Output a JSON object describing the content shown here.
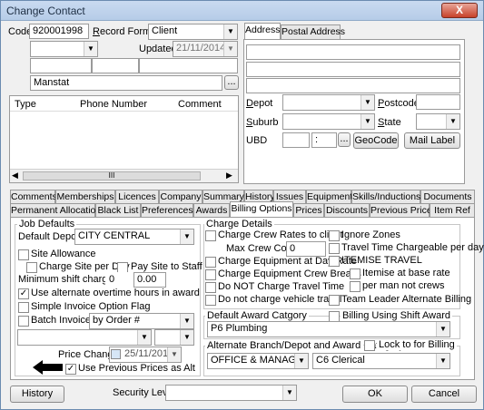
{
  "window": {
    "title": "Change Contact",
    "close_label": "X"
  },
  "header": {
    "code_label": "Code",
    "code_value": "920001998",
    "record_format_label": "Record Format",
    "record_format_value": "Client",
    "updated_label": "Updated",
    "updated_value": "21/11/2014",
    "name_value": "Manstat",
    "more_button": "..."
  },
  "phones": {
    "columns": [
      "Type",
      "Phone Number",
      "Comment"
    ],
    "scroll_grip": "III"
  },
  "address": {
    "tabs": [
      "Address",
      "Postal Address"
    ],
    "depot_label": "Depot",
    "postcode_label": "Postcode",
    "suburb_label": "Suburb",
    "state_label": "State",
    "ubd_label": "UBD",
    "ubd_sep": ":",
    "ubd_more": "...",
    "geocode_button": "GeoCode",
    "mail_label_button": "Mail Label"
  },
  "main_tabs": [
    "Comments",
    "Memberships",
    "Licences",
    "Company",
    "Summary",
    "History",
    "Issues",
    "Equipment",
    "Skills/Inductions",
    "Documents",
    "Permanent Allocations",
    "Black List",
    "Preferences",
    "Awards",
    "Billing Options",
    "Prices",
    "Discounts",
    "Previous Prices",
    "Item Ref"
  ],
  "job_defaults": {
    "group_label": "Job Defaults",
    "default_depot_label": "Default Depot",
    "default_depot_value": "CITY CENTRAL",
    "site_allowance": "Site Allowance",
    "charge_site_per_day": "Charge Site per Day",
    "pay_site_to_staff": "Pay Site to Staff",
    "min_shift_label": "Minimum shift charge",
    "min_shift_value": "0",
    "min_shift_amount": "0.00",
    "use_alternate_overtime": "Use alternate overtime hours in award",
    "simple_invoice": "Simple Invoice Option Flag",
    "batch_invoices": "Batch Invoices",
    "batch_invoices_value": "by Order #",
    "price_change_label": "Price Change",
    "price_change_value": "25/11/2014",
    "use_previous_prices": "Use Previous Prices as Alt"
  },
  "charge_details": {
    "group_label": "Charge Details",
    "charge_crew_rates": "Charge Crew Rates to client",
    "max_crew_count_label": "Max Crew Count",
    "max_crew_count_value": "0",
    "charge_equipment_day_rate": "Charge Equipment at Day Rate",
    "charge_equipment_crew_breaks": "Charge Equipment Crew Breaks",
    "do_not_charge_travel": "Do NOT Charge Travel Time",
    "do_not_charge_vehicle": "Do not charge vehicle travel",
    "ignore_zones": "Ignore Zones",
    "travel_time_chargeable": "Travel Time Chargeable per day",
    "itemise_travel": "ITEMISE TRAVEL",
    "itemise_base_rate": "Itemise at base rate",
    "per_man_not_crews": "per man not crews",
    "team_leader_alternate": "Team Leader Alternate Billing"
  },
  "award": {
    "default_award_label": "Default Award Catgory",
    "default_award_value": "P6 Plumbing",
    "billing_using_shift_award": "Billing Using Shift Award",
    "alt_branch_label": "Alternate Branch/Depot and Award Category",
    "lock_for_billing": "Lock to for Billing",
    "alt_branch_value": "OFFICE & MANAGEMEN",
    "alt_award_value": "C6 Clerical"
  },
  "footer": {
    "history_button": "History",
    "security_level_label": "Security Level",
    "ok_button": "OK",
    "cancel_button": "Cancel"
  }
}
